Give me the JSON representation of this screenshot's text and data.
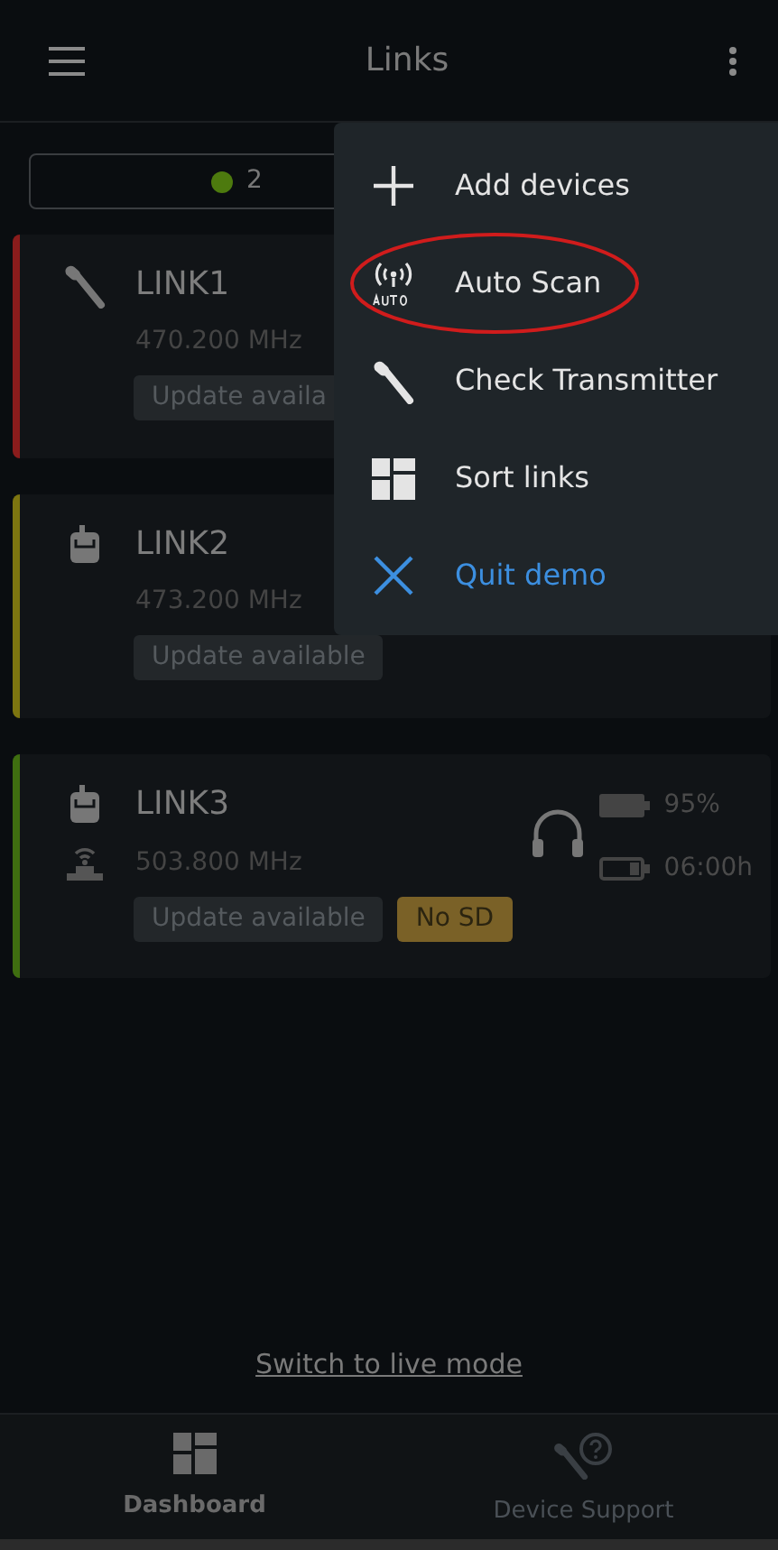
{
  "header": {
    "title": "Links"
  },
  "filter": {
    "count": "2",
    "color": "#4d7a0e"
  },
  "links": [
    {
      "name": "LINK1",
      "kind": "handheld",
      "frequency": "470.200 MHz",
      "color": "#8a1c1c",
      "badges": [
        {
          "text": "Update availa",
          "kind": "update"
        }
      ]
    },
    {
      "name": "LINK2",
      "kind": "bodypack",
      "frequency": "473.200 MHz",
      "color": "#7d7510",
      "badges": [
        {
          "text": "Update available",
          "kind": "update"
        }
      ]
    },
    {
      "name": "LINK3",
      "kind": "bodypack",
      "receiver": true,
      "frequency": "503.800 MHz",
      "color": "#3f6e10",
      "battery": "95%",
      "runtime": "06:00h",
      "headphones": true,
      "badges": [
        {
          "text": "Update available",
          "kind": "update"
        },
        {
          "text": "No SD",
          "kind": "warning"
        }
      ]
    }
  ],
  "menu": [
    {
      "label": "Add devices",
      "kind": "add",
      "highlighted": false
    },
    {
      "label": "Auto Scan",
      "kind": "scan",
      "highlighted": true
    },
    {
      "label": "Check Transmitter",
      "kind": "check",
      "highlighted": false
    },
    {
      "label": "Sort links",
      "kind": "sort",
      "highlighted": false
    },
    {
      "label": "Quit demo",
      "kind": "quit",
      "highlighted": false
    }
  ],
  "live_mode_link": "Switch to live mode",
  "bottom_nav": [
    {
      "label": "Dashboard",
      "kind": "dashboard",
      "selected": true
    },
    {
      "label": "Device Support",
      "kind": "support",
      "selected": false
    }
  ]
}
